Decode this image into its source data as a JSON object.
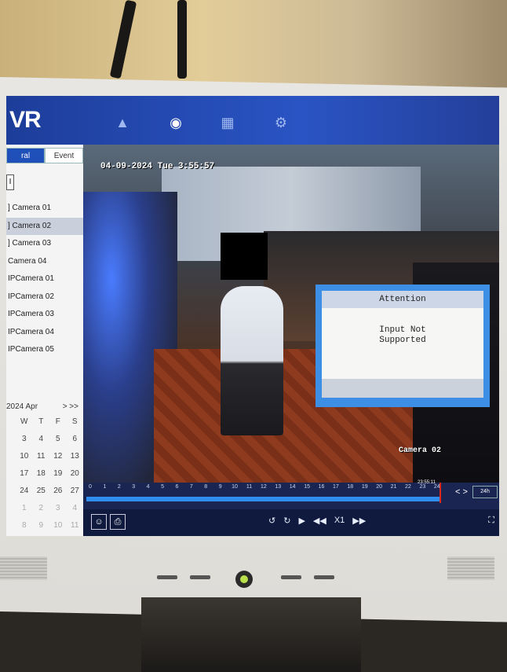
{
  "app": {
    "logo": "VR"
  },
  "nav": {
    "icons": [
      "camera-icon",
      "playback-icon",
      "file-search-icon",
      "settings-icon"
    ]
  },
  "top_right_icons": [
    "info-icon",
    "record-icon",
    "fire-extinguisher-icon",
    "download-icon"
  ],
  "sidebar": {
    "tabs": [
      {
        "label": "ral",
        "active": true
      },
      {
        "label": "Event",
        "active": false
      }
    ],
    "collapse_label": "I",
    "cameras": [
      {
        "label": "] Camera 01",
        "selected": false
      },
      {
        "label": "] Camera 02",
        "selected": true
      },
      {
        "label": "] Camera 03",
        "selected": false
      },
      {
        "label": "Camera 04",
        "selected": false
      },
      {
        "label": "IPCamera 01",
        "selected": false
      },
      {
        "label": "IPCamera 02",
        "selected": false
      },
      {
        "label": "IPCamera 03",
        "selected": false
      },
      {
        "label": "IPCamera 04",
        "selected": false
      },
      {
        "label": "IPCamera 05",
        "selected": false
      }
    ]
  },
  "calendar": {
    "month": "2024 Apr",
    "nav": "> >>",
    "weekdays": [
      "W",
      "T",
      "F",
      "S"
    ],
    "rows": [
      [
        "3",
        "4",
        "5",
        "6"
      ],
      [
        "10",
        "11",
        "12",
        "13"
      ],
      [
        "17",
        "18",
        "19",
        "20"
      ],
      [
        "24",
        "25",
        "26",
        "27"
      ],
      [
        "1",
        "2",
        "3",
        "4"
      ],
      [
        "8",
        "9",
        "10",
        "11"
      ]
    ]
  },
  "video": {
    "datetime": "04-09-2024 Tue  3:55:57",
    "camera_label": "Camera 02"
  },
  "dialog": {
    "title": "Attention",
    "line1": "Input Not",
    "line2": "Supported"
  },
  "timeline": {
    "ticks": [
      "0",
      "1",
      "2",
      "3",
      "4",
      "5",
      "6",
      "7",
      "8",
      "9",
      "10",
      "11",
      "12",
      "13",
      "14",
      "15",
      "16",
      "17",
      "18",
      "19",
      "20",
      "21",
      "22",
      "23",
      "24"
    ],
    "current_time": "23:55:11",
    "nav": "< >",
    "zoom": "24h"
  },
  "controls": {
    "speed": "X1"
  },
  "accent": "#2f8ef0",
  "marker_color": "#e0281c"
}
